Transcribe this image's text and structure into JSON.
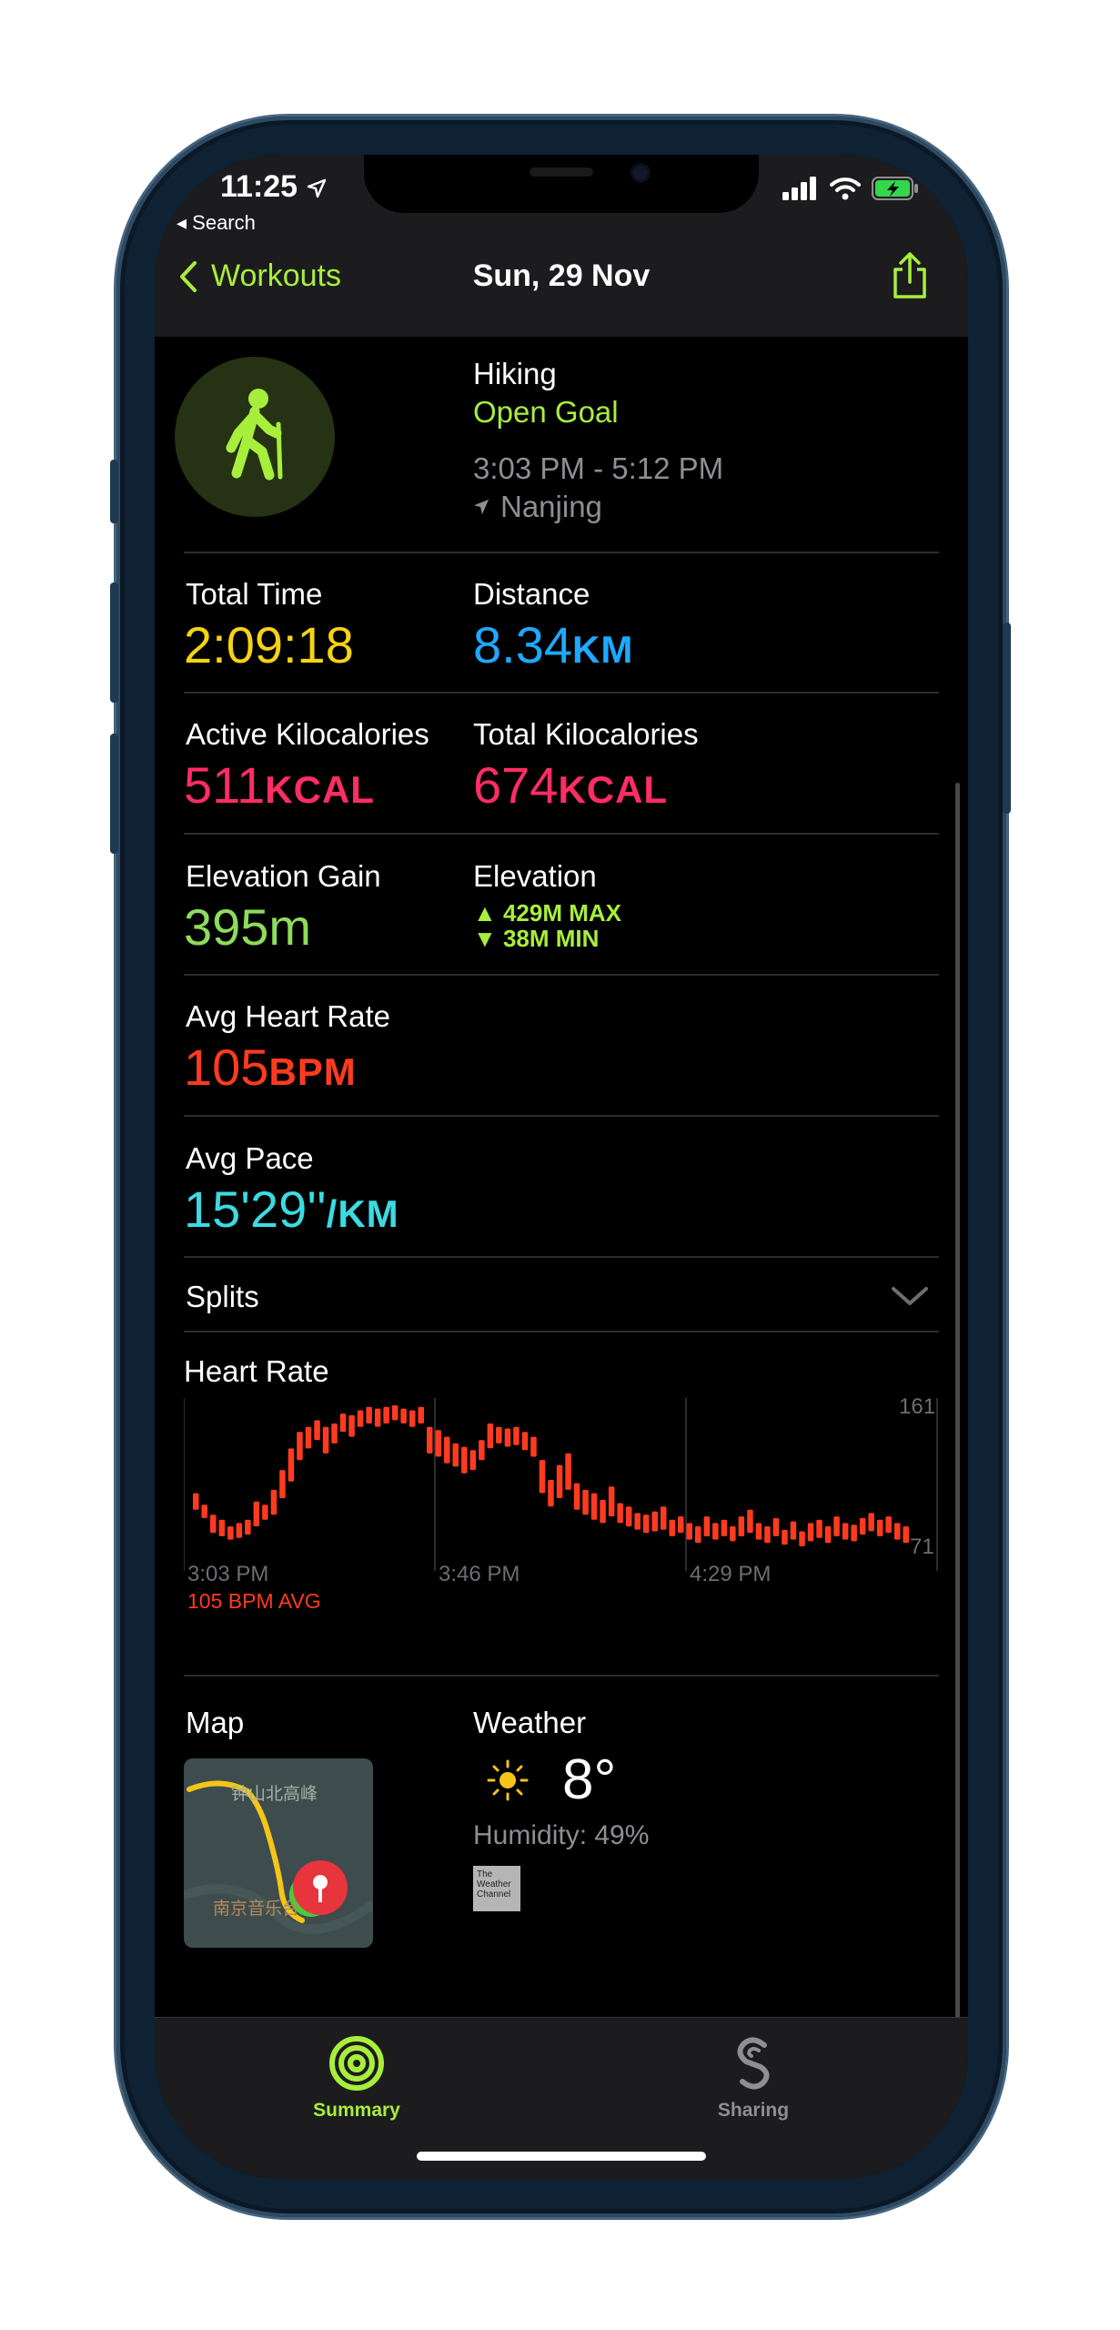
{
  "status_bar": {
    "time": "11:25",
    "back_app": "◂ Search"
  },
  "nav": {
    "back_label": "Workouts",
    "title": "Sun, 29 Nov"
  },
  "workout": {
    "type": "Hiking",
    "goal": "Open Goal",
    "time_range": "3:03 PM - 5:12 PM",
    "location": "Nanjing",
    "icon": "hiking-figure"
  },
  "metrics": {
    "total_time": {
      "label": "Total Time",
      "value": "2:09:18"
    },
    "distance": {
      "label": "Distance",
      "value": "8.34",
      "unit": "KM"
    },
    "active_kcal": {
      "label": "Active Kilocalories",
      "value": "511",
      "unit": "KCAL"
    },
    "total_kcal": {
      "label": "Total Kilocalories",
      "value": "674",
      "unit": "KCAL"
    },
    "elevation_gain": {
      "label": "Elevation Gain",
      "value": "395m"
    },
    "elevation": {
      "label": "Elevation",
      "max": "▲ 429M MAX",
      "min": "▼ 38M MIN"
    },
    "avg_hr": {
      "label": "Avg Heart Rate",
      "value": "105",
      "unit": "BPM"
    },
    "avg_pace": {
      "label": "Avg Pace",
      "value": "15'29''",
      "unit": "/KM"
    }
  },
  "splits": {
    "label": "Splits"
  },
  "heart_rate": {
    "title": "Heart Rate",
    "max_label": "161",
    "min_label": "71",
    "time_labels": [
      "3:03 PM",
      "3:46 PM",
      "4:29 PM"
    ],
    "avg_label": "105 BPM AVG"
  },
  "chart_data": {
    "type": "bar",
    "title": "Heart Rate",
    "xlabel": "",
    "ylabel": "",
    "ylim": [
      71,
      161
    ],
    "x_ticks": [
      "3:03 PM",
      "3:46 PM",
      "4:29 PM"
    ],
    "series": [
      {
        "values": [
          [
            98,
            108
          ],
          [
            93,
            101
          ],
          [
            84,
            95
          ],
          [
            82,
            92
          ],
          [
            80,
            88
          ],
          [
            81,
            90
          ],
          [
            83,
            92
          ],
          [
            88,
            103
          ],
          [
            92,
            101
          ],
          [
            95,
            110
          ],
          [
            105,
            122
          ],
          [
            115,
            135
          ],
          [
            128,
            145
          ],
          [
            135,
            148
          ],
          [
            140,
            152
          ],
          [
            132,
            148
          ],
          [
            138,
            150
          ],
          [
            145,
            156
          ],
          [
            142,
            155
          ],
          [
            148,
            158
          ],
          [
            150,
            160
          ],
          [
            148,
            159
          ],
          [
            150,
            160
          ],
          [
            152,
            161
          ],
          [
            150,
            159
          ],
          [
            148,
            158
          ],
          [
            150,
            160
          ],
          [
            132,
            148
          ],
          [
            130,
            146
          ],
          [
            126,
            142
          ],
          [
            124,
            138
          ],
          [
            120,
            136
          ],
          [
            122,
            134
          ],
          [
            128,
            140
          ],
          [
            135,
            150
          ],
          [
            138,
            148
          ],
          [
            136,
            147
          ],
          [
            137,
            148
          ],
          [
            134,
            145
          ],
          [
            130,
            142
          ],
          [
            108,
            128
          ],
          [
            100,
            116
          ],
          [
            105,
            125
          ],
          [
            110,
            132
          ],
          [
            98,
            114
          ],
          [
            95,
            110
          ],
          [
            92,
            108
          ],
          [
            90,
            104
          ],
          [
            94,
            112
          ],
          [
            90,
            102
          ],
          [
            88,
            100
          ],
          [
            86,
            96
          ],
          [
            84,
            95
          ],
          [
            85,
            97
          ],
          [
            86,
            100
          ],
          [
            82,
            92
          ],
          [
            84,
            94
          ],
          [
            80,
            90
          ],
          [
            78,
            88
          ],
          [
            82,
            94
          ],
          [
            80,
            90
          ],
          [
            82,
            92
          ],
          [
            79,
            88
          ],
          [
            82,
            94
          ],
          [
            84,
            98
          ],
          [
            80,
            90
          ],
          [
            78,
            88
          ],
          [
            82,
            93
          ],
          [
            77,
            86
          ],
          [
            80,
            91
          ],
          [
            76,
            85
          ],
          [
            79,
            90
          ],
          [
            81,
            92
          ],
          [
            78,
            88
          ],
          [
            82,
            94
          ],
          [
            80,
            90
          ],
          [
            79,
            89
          ],
          [
            83,
            93
          ],
          [
            85,
            96
          ],
          [
            82,
            92
          ],
          [
            84,
            94
          ],
          [
            80,
            90
          ],
          [
            78,
            88
          ]
        ]
      }
    ]
  },
  "map": {
    "label": "Map",
    "text_peak": "钟山北高峰",
    "text_venue": "南京音乐台"
  },
  "weather": {
    "label": "Weather",
    "temperature": "8°",
    "humidity": "Humidity: 49%",
    "provider_logo": "The Weather Channel",
    "icon": "sun-icon"
  },
  "tabs": [
    {
      "label": "Summary",
      "active": true,
      "icon": "activity-rings-icon"
    },
    {
      "label": "Sharing",
      "active": false,
      "icon": "sharing-icon"
    }
  ],
  "colors": {
    "green": "#a8ee3c",
    "yellow": "#f5d313",
    "blue": "#1fa8ff",
    "pink": "#ff2d63",
    "lime": "#8fdc5a",
    "red": "#ff3b1f",
    "cyan": "#3bdbe3"
  }
}
